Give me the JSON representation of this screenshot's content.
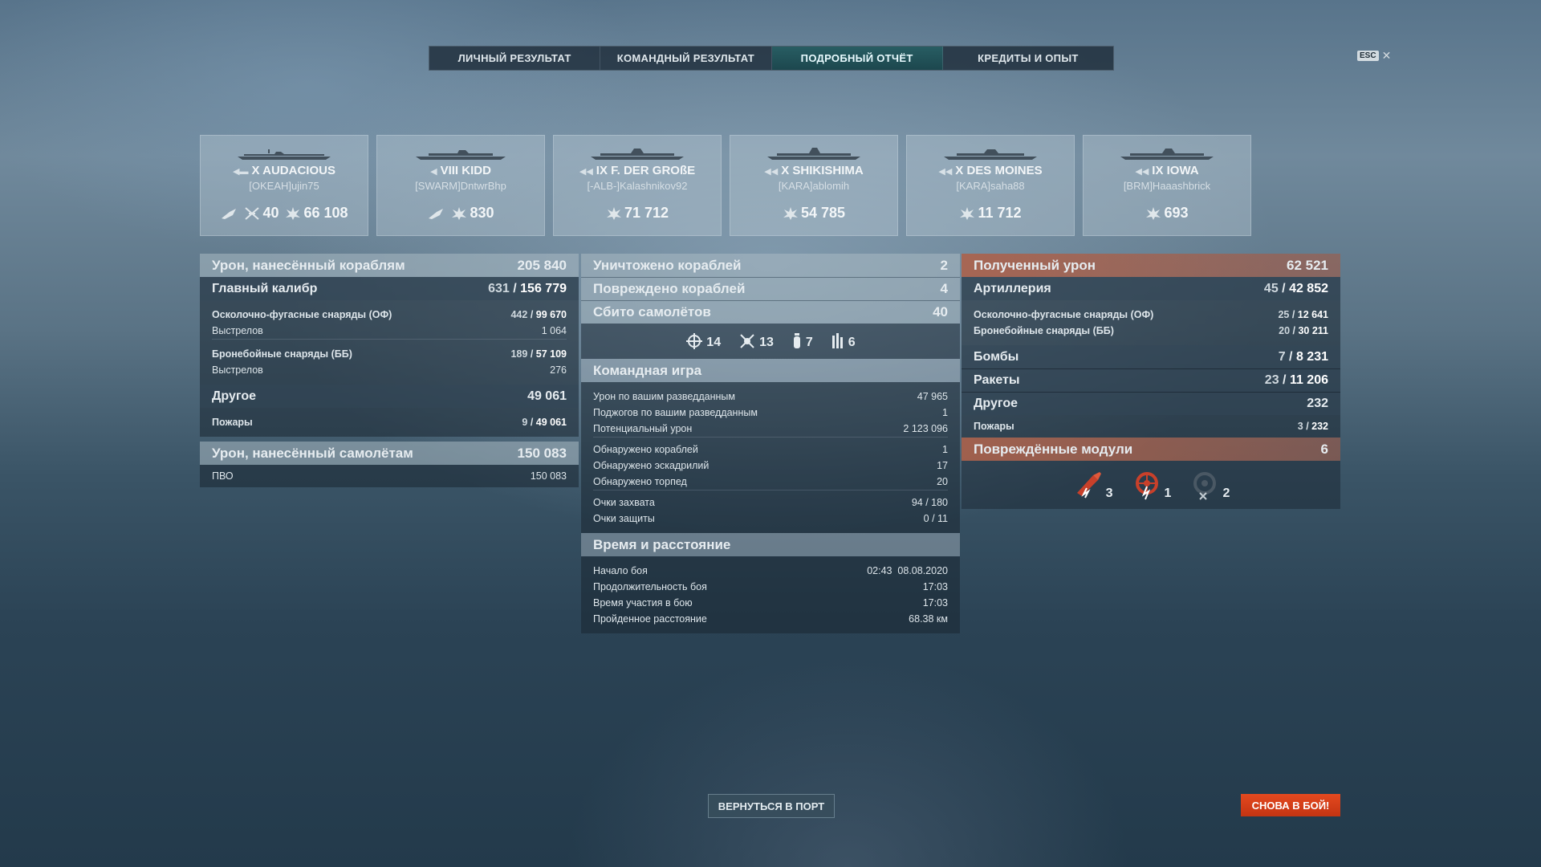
{
  "tabs": [
    "ЛИЧНЫЙ РЕЗУЛЬТАТ",
    "КОМАНДНЫЙ РЕЗУЛЬТАТ",
    "ПОДРОБНЫЙ ОТЧЁТ",
    "КРЕДИТЫ И ОПЫТ"
  ],
  "active_tab": "ПОДРОБНЫЙ ОТЧЁТ",
  "esc": {
    "key": "ESC",
    "close": "✕"
  },
  "ships": [
    {
      "tier_name": "X AUDACIOUS",
      "player": "[OKEAH]ujin75",
      "class_icon": "aircraft-carrier-icon",
      "stat_planes": "40",
      "stat_damage": "66 108"
    },
    {
      "tier_name": "VIII KIDD",
      "player": "[SWARM]DntwrBhp",
      "class_icon": "destroyer-icon",
      "stat_damage": "830"
    },
    {
      "tier_name": "IX F. DER GROßE",
      "player": "[-ALB-]Kalashnikov92",
      "class_icon": "battleship-icon",
      "stat_damage": "71 712"
    },
    {
      "tier_name": "X SHIKISHIMA",
      "player": "[KARA]ablomih",
      "class_icon": "battleship-icon",
      "stat_damage": "54 785"
    },
    {
      "tier_name": "X DES MOINES",
      "player": "[KARA]saha88",
      "class_icon": "cruiser-icon",
      "stat_damage": "11 712"
    },
    {
      "tier_name": "IX IOWA",
      "player": "[BRM]Haaashbrick",
      "class_icon": "battleship-icon",
      "stat_damage": "693"
    }
  ],
  "damage_ships": {
    "title": "Урон, нанесённый кораблям",
    "value": "205 840",
    "main_caliber": {
      "label": "Главный калибр",
      "hits": "631",
      "damage": "156 779"
    },
    "he": {
      "label": "Осколочно-фугасные снаряды (ОФ)",
      "hits": "442",
      "damage": "99 670"
    },
    "he_shots": {
      "label": "Выстрелов",
      "value": "1 064"
    },
    "ap": {
      "label": "Бронебойные снаряды (ББ)",
      "hits": "189",
      "damage": "57 109"
    },
    "ap_shots": {
      "label": "Выстрелов",
      "value": "276"
    },
    "other": {
      "label": "Другое",
      "value": "49 061"
    },
    "fires": {
      "label": "Пожары",
      "count": "9",
      "damage": "49 061"
    }
  },
  "damage_planes": {
    "title": "Урон, нанесённый самолётам",
    "value": "150 083",
    "aa": {
      "label": "ПВО",
      "value": "150 083"
    }
  },
  "kills": {
    "destroyed": {
      "label": "Уничтожено кораблей",
      "value": "2"
    },
    "damaged": {
      "label": "Повреждено кораблей",
      "value": "4"
    },
    "planes": {
      "label": "Сбито самолётов",
      "value": "40"
    },
    "plane_types": {
      "fighters": "14",
      "attack": "13",
      "bombers": "7",
      "torpedo": "6"
    }
  },
  "team": {
    "title": "Командная игра",
    "rows1": [
      {
        "label": "Урон по вашим разведданным",
        "value": "47 965"
      },
      {
        "label": "Поджогов по вашим разведданным",
        "value": "1"
      },
      {
        "label": "Потенциальный урон",
        "value": "2 123 096"
      }
    ],
    "rows2": [
      {
        "label": "Обнаружено кораблей",
        "value": "1"
      },
      {
        "label": "Обнаружено эскадрилий",
        "value": "17"
      },
      {
        "label": "Обнаружено торпед",
        "value": "20"
      }
    ],
    "rows3": [
      {
        "label": "Очки захвата",
        "value": "94 / 180"
      },
      {
        "label": "Очки защиты",
        "value": "0 / 11"
      }
    ]
  },
  "time": {
    "title": "Время и расстояние",
    "rows": [
      {
        "label": "Начало боя",
        "value": "02:43  08.08.2020"
      },
      {
        "label": "Продолжительность боя",
        "value": "17:03"
      },
      {
        "label": "Время участия в бою",
        "value": "17:03"
      },
      {
        "label": "Пройденное расстояние",
        "value": "68.38 км"
      }
    ]
  },
  "received": {
    "title": "Полученный урон",
    "value": "62 521",
    "artillery": {
      "label": "Артиллерия",
      "hits": "45",
      "damage": "42 852"
    },
    "he": {
      "label": "Осколочно-фугасные снаряды (ОФ)",
      "hits": "25",
      "damage": "12 641"
    },
    "ap": {
      "label": "Бронебойные снаряды (ББ)",
      "hits": "20",
      "damage": "30 211"
    },
    "bombs": {
      "label": "Бомбы",
      "hits": "7",
      "damage": "8 231"
    },
    "rockets": {
      "label": "Ракеты",
      "hits": "23",
      "damage": "11 206"
    },
    "other": {
      "label": "Другое",
      "value": "232"
    },
    "fires": {
      "label": "Пожары",
      "count": "3",
      "damage": "232"
    }
  },
  "modules": {
    "title": "Повреждённые модули",
    "value": "6",
    "items": [
      {
        "icon": "main-battery-icon",
        "count": "3"
      },
      {
        "icon": "steering-gear-icon",
        "count": "1"
      },
      {
        "icon": "engine-icon",
        "count": "2"
      }
    ]
  },
  "buttons": {
    "port": "ВЕРНУТЬСЯ В ПОРТ",
    "battle": "СНОВА В БОЙ!"
  },
  "colors": {
    "accent_tab": "#285f64",
    "received_header": "#af5f46",
    "battle_button": "#d63d18"
  }
}
